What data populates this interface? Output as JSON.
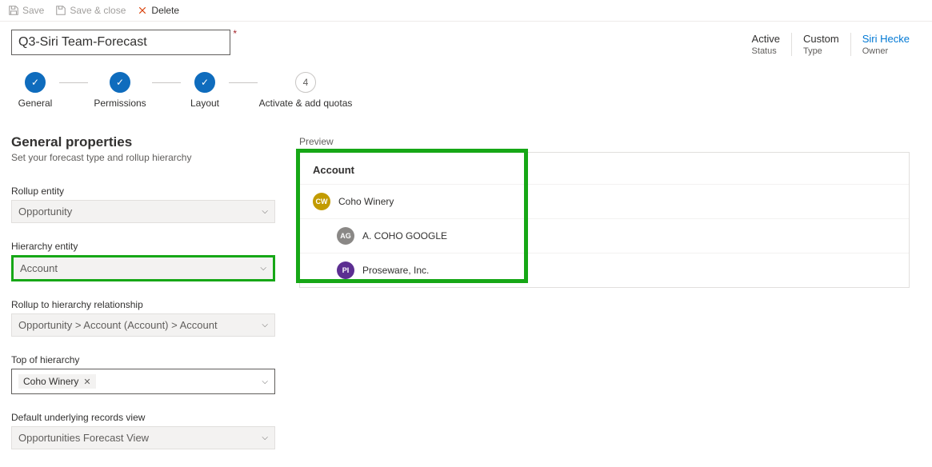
{
  "toolbar": {
    "save": "Save",
    "save_close": "Save & close",
    "delete": "Delete"
  },
  "title": "Q3-Siri Team-Forecast",
  "meta": {
    "status_val": "Active",
    "status_lbl": "Status",
    "type_val": "Custom",
    "type_lbl": "Type",
    "owner_val": "Siri Hecke",
    "owner_lbl": "Owner"
  },
  "steps": {
    "s1": "General",
    "s2": "Permissions",
    "s3": "Layout",
    "s4": "Activate & add quotas",
    "s4_num": "4"
  },
  "section": {
    "title": "General properties",
    "sub": "Set your forecast type and rollup hierarchy"
  },
  "fields": {
    "rollup_entity_lbl": "Rollup entity",
    "rollup_entity_val": "Opportunity",
    "hierarchy_entity_lbl": "Hierarchy entity",
    "hierarchy_entity_val": "Account",
    "rollup_rel_lbl": "Rollup to hierarchy relationship",
    "rollup_rel_val": "Opportunity > Account (Account) > Account",
    "top_lbl": "Top of hierarchy",
    "top_val": "Coho Winery",
    "default_view_lbl": "Default underlying records view",
    "default_view_val": "Opportunities Forecast View"
  },
  "preview": {
    "label": "Preview",
    "header": "Account",
    "rows": [
      {
        "initials": "CW",
        "name": "Coho Winery",
        "color": "#c29b00"
      },
      {
        "initials": "AG",
        "name": "A. COHO GOOGLE",
        "color": "#8a8886",
        "child": true
      },
      {
        "initials": "PI",
        "name": "Proseware, Inc.",
        "color": "#5c2e91",
        "child": true
      }
    ]
  }
}
